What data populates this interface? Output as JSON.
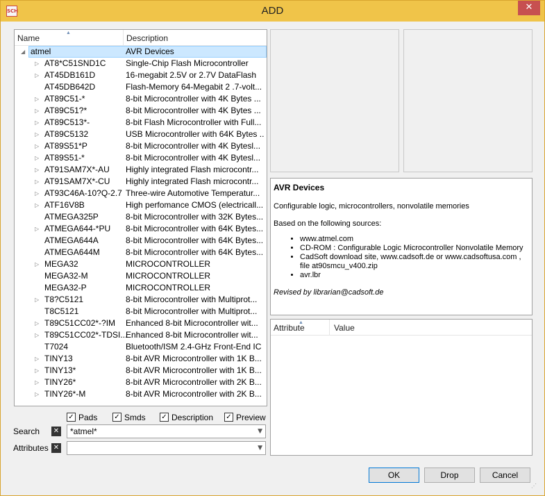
{
  "window": {
    "title": "ADD",
    "icon_text": "SCH",
    "close": "✕"
  },
  "tree": {
    "columns": {
      "name": "Name",
      "description": "Description"
    },
    "rows": [
      {
        "name": "atmel",
        "desc": "AVR Devices",
        "expander": "◢",
        "selected": true,
        "level": 0
      },
      {
        "name": "AT8*C51SND1C",
        "desc": "Single-Chip Flash Microcontroller",
        "expander": "▷",
        "level": 1
      },
      {
        "name": "AT45DB161D",
        "desc": "16-megabit 2.5V or 2.7V DataFlash",
        "expander": "▷",
        "level": 1
      },
      {
        "name": "AT45DB642D",
        "desc": "Flash-Memory 64-Megabit 2 .7-volt...",
        "expander": "",
        "level": 1
      },
      {
        "name": "AT89C51-*",
        "desc": "8-bit Microcontroller with 4K Bytes ...",
        "expander": "▷",
        "level": 1
      },
      {
        "name": "AT89C51?*",
        "desc": "8-bit Microcontroller with 4K Bytes ...",
        "expander": "▷",
        "level": 1
      },
      {
        "name": "AT89C513*-",
        "desc": "8-bit Flash Microcontroller with Full...",
        "expander": "▷",
        "level": 1
      },
      {
        "name": "AT89C5132",
        "desc": "USB Microcontroller with 64K Bytes ...",
        "expander": "▷",
        "level": 1
      },
      {
        "name": "AT89S51*P",
        "desc": "8-bit Microcontroller with 4K Bytesl...",
        "expander": "▷",
        "level": 1
      },
      {
        "name": "AT89S51-*",
        "desc": "8-bit Microcontroller with 4K Bytesl...",
        "expander": "▷",
        "level": 1
      },
      {
        "name": "AT91SAM7X*-AU",
        "desc": "Highly integrated Flash microcontr...",
        "expander": "▷",
        "level": 1
      },
      {
        "name": "AT91SAM7X*-CU",
        "desc": "Highly integrated Flash microcontr...",
        "expander": "▷",
        "level": 1
      },
      {
        "name": "AT93C46A-10?Q-2.7",
        "desc": "Three-wire Automotive Temperatur...",
        "expander": "▷",
        "level": 1
      },
      {
        "name": "ATF16V8B",
        "desc": "High perfomance CMOS (electricall...",
        "expander": "▷",
        "level": 1
      },
      {
        "name": "ATMEGA325P",
        "desc": "8-bit Microcontroller with 32K Bytes...",
        "expander": "",
        "level": 1
      },
      {
        "name": "ATMEGA644-*PU",
        "desc": "8-bit Microcontroller with 64K Bytes...",
        "expander": "▷",
        "level": 1
      },
      {
        "name": "ATMEGA644A",
        "desc": "8-bit Microcontroller with 64K Bytes...",
        "expander": "",
        "level": 1
      },
      {
        "name": "ATMEGA644M",
        "desc": "8-bit Microcontroller with 64K Bytes...",
        "expander": "",
        "level": 1
      },
      {
        "name": "MEGA32",
        "desc": "MICROCONTROLLER",
        "expander": "▷",
        "level": 1
      },
      {
        "name": "MEGA32-M",
        "desc": "MICROCONTROLLER",
        "expander": "",
        "level": 1
      },
      {
        "name": "MEGA32-P",
        "desc": "MICROCONTROLLER",
        "expander": "",
        "level": 1
      },
      {
        "name": "T8?C5121",
        "desc": "8-bit Microcontroller with Multiprot...",
        "expander": "▷",
        "level": 1
      },
      {
        "name": "T8C5121",
        "desc": "8-bit Microcontroller with Multiprot...",
        "expander": "",
        "level": 1
      },
      {
        "name": "T89C51CC02*-?IM",
        "desc": "Enhanced 8-bit Microcontroller wit...",
        "expander": "▷",
        "level": 1
      },
      {
        "name": "T89C51CC02*-TDSI...",
        "desc": "Enhanced 8-bit Microcontroller wit...",
        "expander": "▷",
        "level": 1
      },
      {
        "name": "T7024",
        "desc": "Bluetooth/ISM 2.4-GHz Front-End IC",
        "expander": "",
        "level": 1
      },
      {
        "name": "TINY13",
        "desc": "8-bit AVR Microcontroller with 1K B...",
        "expander": "▷",
        "level": 1
      },
      {
        "name": "TINY13*",
        "desc": "8-bit AVR Microcontroller with 1K B...",
        "expander": "▷",
        "level": 1
      },
      {
        "name": "TINY26*",
        "desc": "8-bit AVR Microcontroller with 2K B...",
        "expander": "▷",
        "level": 1
      },
      {
        "name": "TINY26*-M",
        "desc": "8-bit AVR Microcontroller with 2K B...",
        "expander": "▷",
        "level": 1
      }
    ]
  },
  "description": {
    "heading": "AVR Devices",
    "summary": "Configurable logic, microcontrollers, nonvolatile memories",
    "sources_intro": "Based on the following sources:",
    "sources": [
      "www.atmel.com",
      "CD-ROM : Configurable Logic Microcontroller Nonvolatile Memory",
      "CadSoft download site, www.cadsoft.de or www.cadsoftusa.com , file at90smcu_v400.zip",
      "avr.lbr"
    ],
    "revised": "Revised by librarian@cadsoft.de"
  },
  "attributes": {
    "columns": {
      "attribute": "Attribute",
      "value": "Value"
    }
  },
  "options": {
    "pads": "Pads",
    "smds": "Smds",
    "description": "Description",
    "preview": "Preview",
    "checked_mark": "✓"
  },
  "search": {
    "label": "Search",
    "value": "*atmel*",
    "clear": "✕"
  },
  "attrfilter": {
    "label": "Attributes",
    "value": "",
    "clear": "✕"
  },
  "buttons": {
    "ok": "OK",
    "drop": "Drop",
    "cancel": "Cancel"
  }
}
